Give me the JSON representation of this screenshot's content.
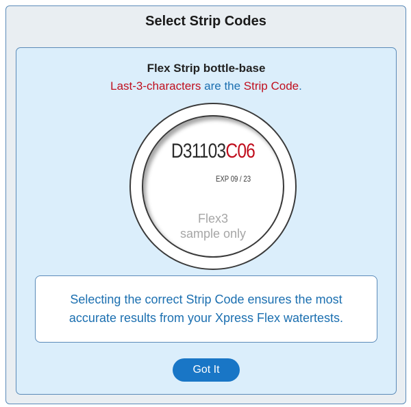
{
  "dialog": {
    "title": "Select Strip Codes"
  },
  "panel": {
    "heading": "Flex Strip bottle-base",
    "subtitle_part1": "Last-3-characters",
    "subtitle_part2": " are the ",
    "subtitle_part3": "Strip Code",
    "subtitle_part4": "."
  },
  "cap_label": {
    "lot_prefix": "D31103",
    "strip_code": "C06",
    "expiry": "EXP 09 / 23",
    "sample_line1": "Flex3",
    "sample_line2": "sample only"
  },
  "note": {
    "text": "Selecting the correct Strip Code ensures the most accurate results from your Xpress Flex watertests."
  },
  "actions": {
    "got_it_label": "Got It"
  },
  "colors": {
    "accent_blue": "#1976c6",
    "text_blue": "#1b6fb0",
    "code_red": "#c00f1e",
    "panel_bg": "#dbeefb",
    "dialog_bg": "#e9eef2"
  }
}
